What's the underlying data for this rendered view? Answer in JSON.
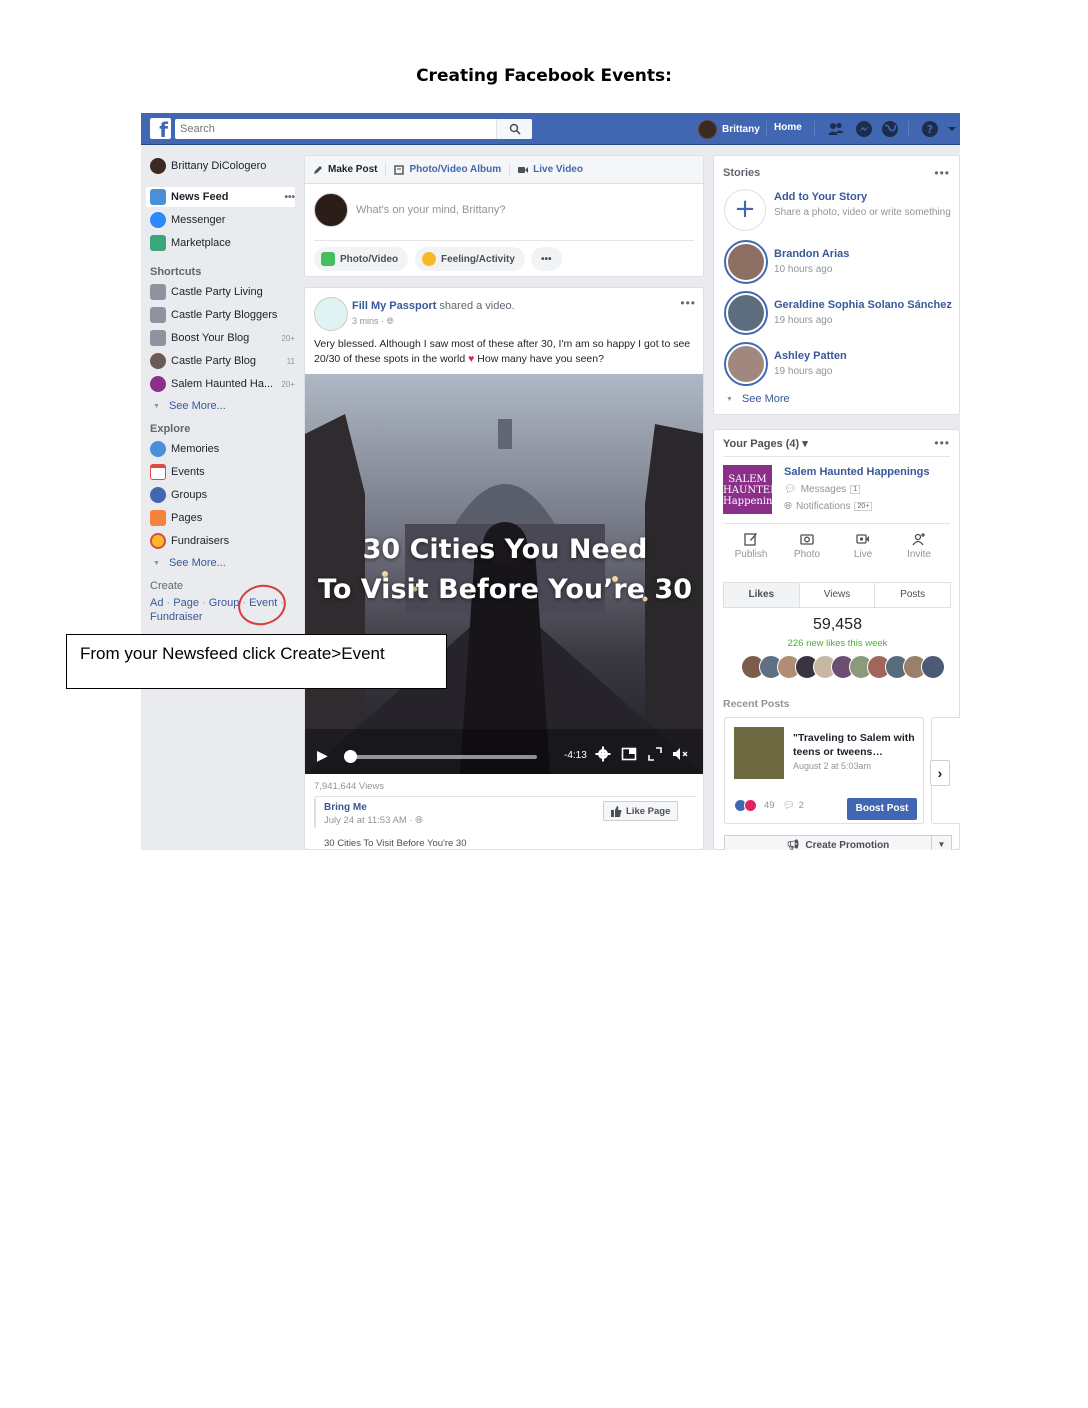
{
  "doc_title": "Creating Facebook Events:",
  "topbar": {
    "search_placeholder": "Search",
    "user_name": "Brittany",
    "home_label": "Home",
    "logo_letter": "f"
  },
  "left": {
    "profile_name": "Brittany DiCologero",
    "nav": [
      {
        "label": "News Feed",
        "icon": "news-feed-icon"
      },
      {
        "label": "Messenger",
        "icon": "messenger-icon"
      },
      {
        "label": "Marketplace",
        "icon": "marketplace-icon"
      }
    ],
    "more_dots": "•••",
    "shortcuts_heading": "Shortcuts",
    "shortcuts": [
      {
        "label": "Castle Party Living",
        "count": ""
      },
      {
        "label": "Castle Party Bloggers",
        "count": ""
      },
      {
        "label": "Boost Your Blog",
        "count": "20+"
      },
      {
        "label": "Castle Party Blog",
        "count": "11"
      },
      {
        "label": "Salem Haunted Ha...",
        "count": "20+"
      }
    ],
    "see_more": "See More...",
    "explore_heading": "Explore",
    "explore": [
      {
        "label": "Memories",
        "icon": "memories-icon"
      },
      {
        "label": "Events",
        "icon": "events-icon"
      },
      {
        "label": "Groups",
        "icon": "groups-icon"
      },
      {
        "label": "Pages",
        "icon": "pages-flag-icon"
      },
      {
        "label": "Fundraisers",
        "icon": "fundraisers-icon"
      }
    ],
    "create_heading": "Create",
    "create_links": {
      "ad": "Ad",
      "page": "Page",
      "group": "Group",
      "event": "Event",
      "fundraiser": "Fundraiser",
      "sep": "·"
    }
  },
  "composer": {
    "tabs": [
      "Make Post",
      "Photo/Video Album",
      "Live Video"
    ],
    "placeholder": "What's on your mind, Brittany?",
    "actions": [
      "Photo/Video",
      "Feeling/Activity"
    ],
    "more": "•••"
  },
  "post": {
    "author": "Fill My Passport",
    "action": "shared a video.",
    "time": "3 mins ·",
    "more": "•••",
    "text": "Very blessed. Although I saw most of these after 30, I'm am so happy I got to see 20/30 of these spots in the world",
    "heart": "♥",
    "text_end": " How many have you seen?",
    "video_title_line1": "30 Cities You Need",
    "video_title_line2": "To Visit Before You’re 30",
    "video_time": "-4:13",
    "views": "7,941,644 Views",
    "shared_from": "Bring Me",
    "shared_time": "July 24 at 11:53 AM ·",
    "like_page": "Like Page",
    "caption": "30 Cities To Visit Before You're 30",
    "progress": 0.03
  },
  "stories": {
    "heading": "Stories",
    "more": "•••",
    "add_title": "Add to Your Story",
    "add_sub": "Share a photo, video or write something",
    "items": [
      {
        "name": "Brandon Arias",
        "time": "10 hours ago"
      },
      {
        "name": "Geraldine Sophia Solano Sánchez",
        "time": "19 hours ago"
      },
      {
        "name": "Ashley Patten",
        "time": "19 hours ago"
      }
    ],
    "see_more": "See More"
  },
  "pages": {
    "heading": "Your Pages (4) ▾",
    "more": "•••",
    "logo_text": "SALEM HAUNTED Happenings",
    "page_name": "Salem Haunted Happenings",
    "messages_label": "Messages",
    "messages_count": "1",
    "notifications_label": "Notifications",
    "notifications_count": "20+",
    "actions": [
      "Publish",
      "Photo",
      "Live",
      "Invite"
    ],
    "tabs": [
      "Likes",
      "Views",
      "Posts"
    ],
    "likes_count": "59,458",
    "new_likes": "226 new likes this week",
    "recent_heading": "Recent Posts",
    "recent_title": "\"Traveling to Salem with teens or tweens…",
    "recent_date": "August 2 at 5:03am",
    "reactions_count": "49",
    "comments_count": "2",
    "boost_label": "Boost Post",
    "create_promotion": "Create Promotion"
  },
  "callout": "From your Newsfeed click Create>Event",
  "colors": {
    "brand": "#4267b2",
    "link": "#385898",
    "circle": "#d93c3c"
  }
}
